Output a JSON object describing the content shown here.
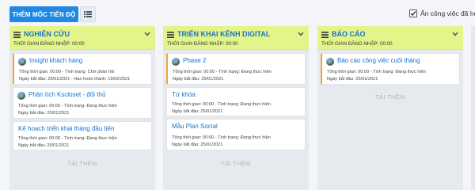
{
  "toolbar": {
    "add_milestone_label": "THÊM MỐC TIẾN ĐỘ",
    "hide_completed_label": "Ẩn công việc đã hoà",
    "hide_completed_checked": true
  },
  "columns": [
    {
      "title": "NGHIÊN CỨU",
      "login_time": "THỜI GIAN ĐĂNG NHẬP: 00:00",
      "load_more": "TẢI THÊM",
      "cards": [
        {
          "title": "Insight khách hàng",
          "avatar": true,
          "warn": true,
          "line1": "Tổng thời gian: 00:00 - Tình trạng: Chờ phản hồi",
          "line2": "Ngày bắt đầu: 25/01/2021 - Hạn hoàn thành: 19/02/2021"
        },
        {
          "title": "Phân tích Kscloset - đối thủ",
          "avatar": true,
          "warn": false,
          "line1": "Tổng thời gian: 00:00 - Tình trạng: Đang thực hiện",
          "line2": "Ngày bắt đầu: 25/01/2021"
        },
        {
          "title": "Kế hoạch triển khai tháng đầu tiên",
          "avatar": false,
          "warn": false,
          "line1": "Tổng thời gian: 00:00 - Tình trạng: Đang thực hiện",
          "line2": "Ngày bắt đầu: 25/01/2021"
        }
      ]
    },
    {
      "title": "TRIỂN KHAI KÊNH DIGITAL",
      "login_time": "THỜI GIAN ĐĂNG NHẬP: 00:00",
      "load_more": "TẢI THÊM",
      "cards": [
        {
          "title": "Phase 2",
          "avatar": true,
          "warn": true,
          "line1": "Tổng thời gian: 00:00 - Tình trạng: Đang thực hiện",
          "line2": "Ngày bắt đầu: 25/01/2021"
        },
        {
          "title": "Từ khóa",
          "avatar": false,
          "warn": false,
          "line1": "Tổng thời gian: 00:00 - Tình trạng: Đang thực hiện",
          "line2": "Ngày bắt đầu: 25/01/2021"
        },
        {
          "title": "Mẫu Plan Social",
          "avatar": false,
          "warn": false,
          "line1": "Tổng thời gian: 00:00 - Tình trạng: Đang thực hiện",
          "line2": "Ngày bắt đầu: 25/01/2021"
        }
      ]
    },
    {
      "title": "BÁO CÁO",
      "login_time": "THỜI GIAN ĐĂNG NHẬP: 00:00",
      "load_more": "TẢI THÊM",
      "cards": [
        {
          "title": "Báo cáo công việc cuối tháng",
          "avatar": true,
          "warn": true,
          "line1": "Tổng thời gian: 00:00 - Tình trạng: Đang thực hiện",
          "line2": "Ngày bắt đầu: 25/01/2021"
        }
      ]
    }
  ],
  "icons": {
    "column_menu": "hamburger-icon",
    "column_collapse": "chevron-down-icon",
    "view_toggle": "list-view-icon",
    "checkbox": "check-icon"
  },
  "colors": {
    "primary": "#1e88e5",
    "header_bg": "#e3f48b",
    "title_blue": "#1a73c8",
    "warning_stripe": "#f0a43a"
  }
}
